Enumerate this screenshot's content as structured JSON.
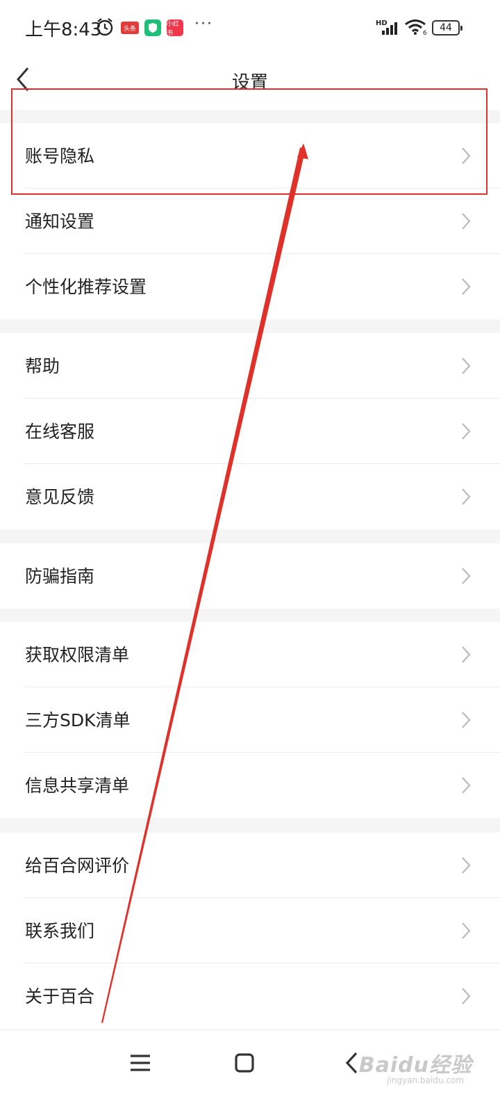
{
  "status_bar": {
    "time": "上午8:43",
    "toutiao_badge": "头条",
    "xhs_badge": "小红书",
    "more": "···",
    "network_label": "HD",
    "battery": "44"
  },
  "header": {
    "title": "设置"
  },
  "sections": [
    {
      "items": [
        {
          "label": "账号隐私"
        },
        {
          "label": "通知设置"
        },
        {
          "label": "个性化推荐设置"
        }
      ]
    },
    {
      "items": [
        {
          "label": "帮助"
        },
        {
          "label": "在线客服"
        },
        {
          "label": "意见反馈"
        }
      ]
    },
    {
      "items": [
        {
          "label": "防骗指南"
        }
      ]
    },
    {
      "items": [
        {
          "label": "获取权限清单"
        },
        {
          "label": "三方SDK清单"
        },
        {
          "label": "信息共享清单"
        }
      ]
    },
    {
      "items": [
        {
          "label": "给百合网评价"
        },
        {
          "label": "联系我们"
        },
        {
          "label": "关于百合"
        }
      ]
    }
  ],
  "watermark": {
    "brand": "Baidu经验",
    "url": "jingyan.baidu.com"
  },
  "colors": {
    "annotation": "#e0302a",
    "background": "#f5f5f5"
  },
  "icons": {
    "back": "chevron-left-icon",
    "row_arrow": "chevron-right-icon",
    "nav_menu": "menu-icon",
    "nav_home": "home-icon",
    "nav_back": "back-icon"
  }
}
